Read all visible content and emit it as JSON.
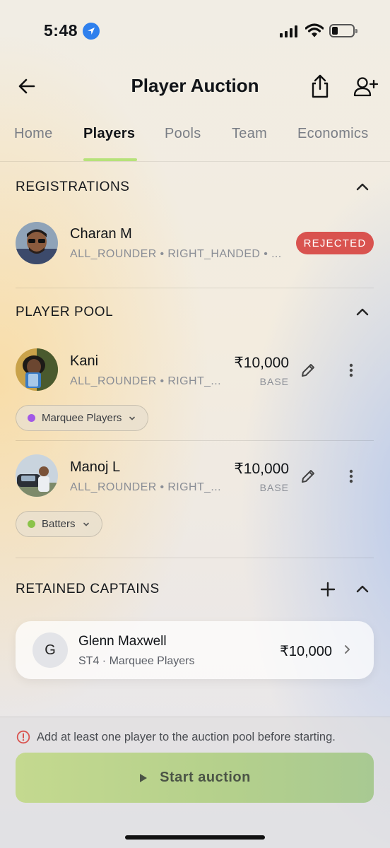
{
  "status_bar": {
    "time": "5:48"
  },
  "header": {
    "title": "Player Auction"
  },
  "tabs": [
    {
      "label": "Home"
    },
    {
      "label": "Players",
      "active": true
    },
    {
      "label": "Pools"
    },
    {
      "label": "Team"
    },
    {
      "label": "Economics"
    }
  ],
  "registrations": {
    "title": "REGISTRATIONS",
    "items": [
      {
        "name": "Charan M",
        "meta": "ALL_ROUNDER • RIGHT_HANDED • ...",
        "status": "REJECTED"
      }
    ]
  },
  "player_pool": {
    "title": "PLAYER POOL",
    "items": [
      {
        "name": "Kani",
        "meta": "ALL_ROUNDER • RIGHT_...",
        "price": "₹10,000",
        "price_label": "BASE",
        "pool": "Marquee Players",
        "pool_color": "#a259e6"
      },
      {
        "name": "Manoj L",
        "meta": "ALL_ROUNDER • RIGHT_...",
        "price": "₹10,000",
        "price_label": "BASE",
        "pool": "Batters",
        "pool_color": "#8bc34a"
      }
    ]
  },
  "retained_captains": {
    "title": "RETAINED CAPTAINS",
    "items": [
      {
        "initial": "G",
        "name": "Glenn Maxwell",
        "meta": "ST4 · Marquee Players",
        "price": "₹10,000"
      }
    ]
  },
  "footer": {
    "warning": "Add at least one player to the auction pool before starting.",
    "start_label": "Start auction"
  },
  "colors": {
    "accent": "#b6e27a",
    "rejected": "#d9534f",
    "button": "#b4d08c",
    "location": "#2f80ed"
  }
}
